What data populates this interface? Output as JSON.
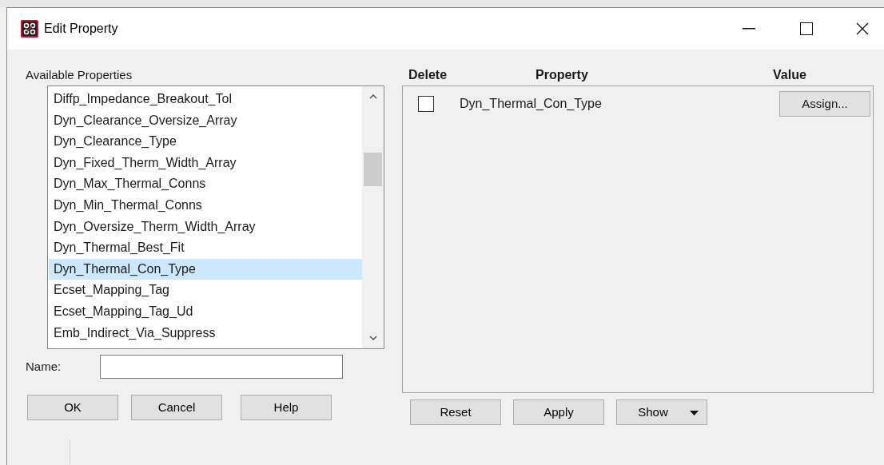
{
  "window": {
    "title": "Edit Property"
  },
  "available": {
    "label": "Available Properties",
    "items": [
      {
        "label": "Diffp_Impedance_Breakout_Tol",
        "selected": false
      },
      {
        "label": "Dyn_Clearance_Oversize_Array",
        "selected": false
      },
      {
        "label": "Dyn_Clearance_Type",
        "selected": false
      },
      {
        "label": "Dyn_Fixed_Therm_Width_Array",
        "selected": false
      },
      {
        "label": "Dyn_Max_Thermal_Conns",
        "selected": false
      },
      {
        "label": "Dyn_Min_Thermal_Conns",
        "selected": false
      },
      {
        "label": "Dyn_Oversize_Therm_Width_Array",
        "selected": false
      },
      {
        "label": "Dyn_Thermal_Best_Fit",
        "selected": false
      },
      {
        "label": "Dyn_Thermal_Con_Type",
        "selected": true
      },
      {
        "label": "Ecset_Mapping_Tag",
        "selected": false
      },
      {
        "label": "Ecset_Mapping_Tag_Ud",
        "selected": false
      },
      {
        "label": "Emb_Indirect_Via_Suppress",
        "selected": false
      }
    ]
  },
  "name_field": {
    "label": "Name:"
  },
  "left_buttons": [
    "OK",
    "Cancel",
    "Help"
  ],
  "table": {
    "columns": [
      "Delete",
      "Property",
      "Value"
    ],
    "rows": [
      {
        "checked": false,
        "property": "Dyn_Thermal_Con_Type",
        "value_button": "Assign..."
      }
    ]
  },
  "right_buttons": [
    {
      "label": "Reset",
      "kind": "plain"
    },
    {
      "label": "Apply",
      "kind": "plain"
    },
    {
      "label": "Show",
      "kind": "dropdown"
    }
  ]
}
